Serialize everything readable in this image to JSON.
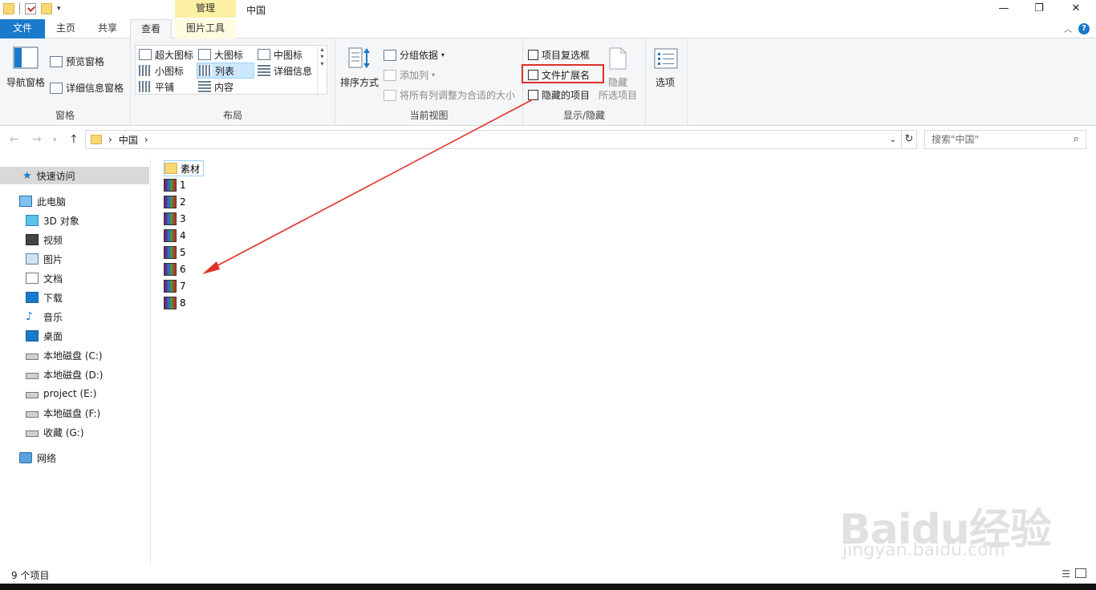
{
  "window": {
    "title": "中国",
    "context_tab": "管理",
    "minimize": "—",
    "maximize": "❐",
    "close": "✕"
  },
  "tabs": {
    "file": "文件",
    "home": "主页",
    "share": "共享",
    "view": "查看",
    "picture_tools": "图片工具"
  },
  "ribbon": {
    "panes": {
      "label": "窗格",
      "nav_pane": "导航窗格",
      "preview_pane": "预览窗格",
      "details_pane": "详细信息窗格"
    },
    "layout": {
      "label": "布局",
      "extra_large": "超大图标",
      "large": "大图标",
      "medium": "中图标",
      "small": "小图标",
      "list": "列表",
      "details": "详细信息",
      "tiles": "平铺",
      "content": "内容"
    },
    "current_view": {
      "label": "当前视图",
      "sort_by": "排序方式",
      "group_by": "分组依据",
      "add_column": "添加列",
      "size_all_columns": "将所有列调整为合适的大小"
    },
    "show_hide": {
      "label": "显示/隐藏",
      "item_checkboxes": "项目复选框",
      "file_extensions": "文件扩展名",
      "hidden_items": "隐藏的项目",
      "hide_selected_1": "隐藏",
      "hide_selected_2": "所选项目"
    },
    "options": "选项"
  },
  "address": {
    "path": "中国",
    "search_placeholder": "搜索\"中国\""
  },
  "sidebar": {
    "quick_access": "快速访问",
    "this_pc": "此电脑",
    "items": [
      "3D 对象",
      "视频",
      "图片",
      "文档",
      "下载",
      "音乐",
      "桌面",
      "本地磁盘 (C:)",
      "本地磁盘 (D:)",
      "project (E:)",
      "本地磁盘 (F:)",
      "收藏 (G:)"
    ],
    "network": "网络"
  },
  "files": {
    "folder": "素材",
    "archives": [
      "1",
      "2",
      "3",
      "4",
      "5",
      "6",
      "7",
      "8"
    ]
  },
  "status": {
    "count": "9 个项目"
  },
  "watermark": {
    "brand": "Baidu经验",
    "url": "jingyan.baidu.com"
  },
  "colors": {
    "accent": "#1979ca",
    "annotation": "#e0302a",
    "context_tab": "#fcf0a3"
  }
}
